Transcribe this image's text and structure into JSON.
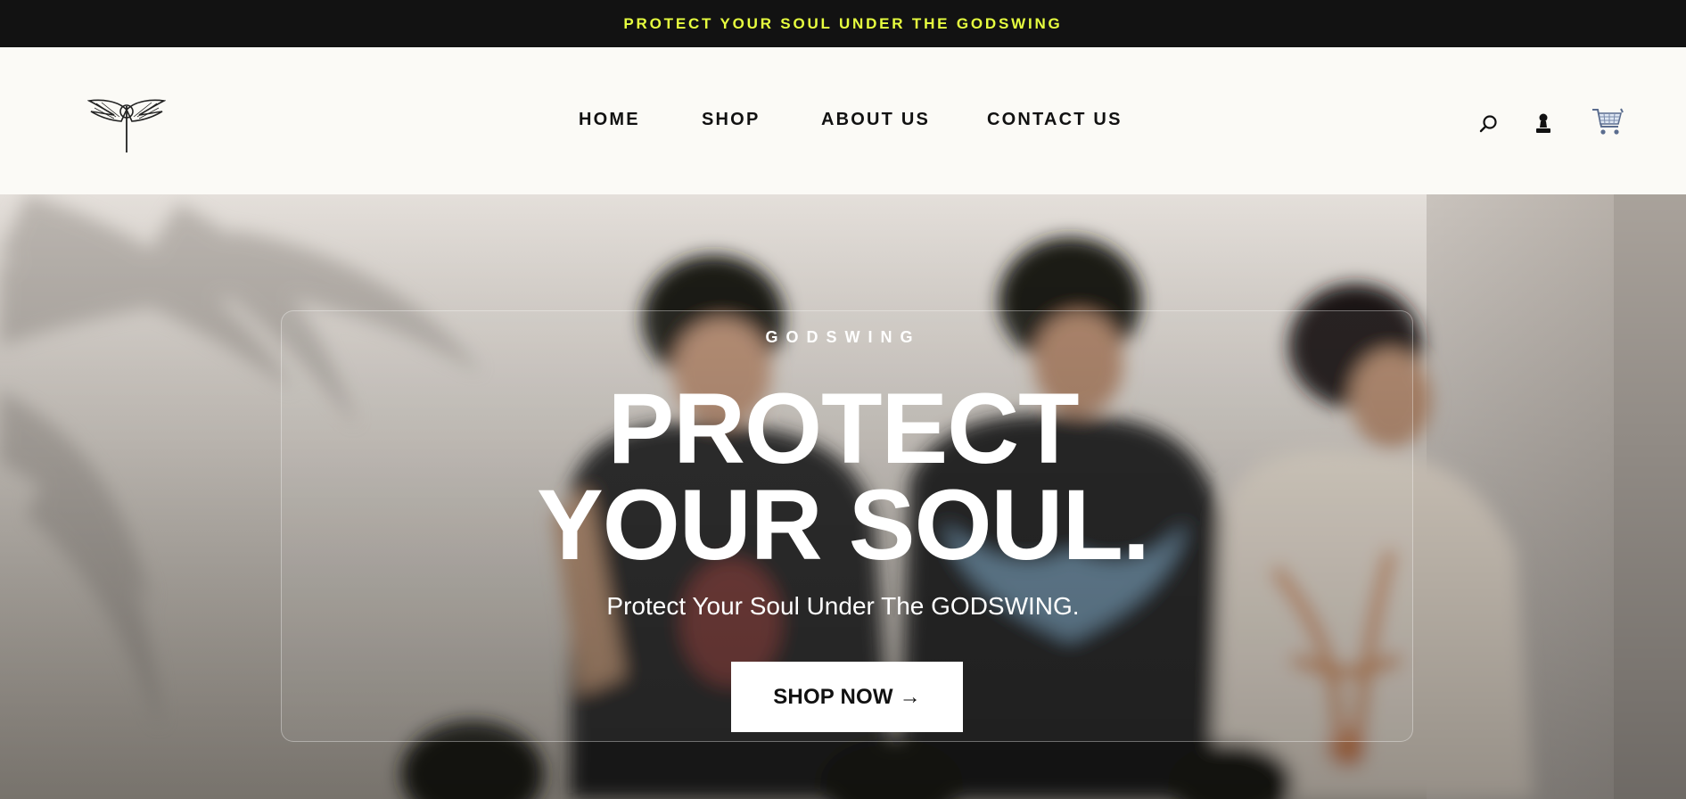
{
  "announcement": {
    "text": "PROTECT YOUR SOUL UNDER THE GODSWING",
    "text_color": "#e7ff3f",
    "background": "#121212"
  },
  "header": {
    "logo_icon": "winged-logo-icon",
    "nav": [
      {
        "label": "HOME"
      },
      {
        "label": "SHOP"
      },
      {
        "label": "ABOUT US"
      },
      {
        "label": "CONTACT US"
      }
    ],
    "icons": [
      "search-icon",
      "account-icon",
      "cart-icon"
    ]
  },
  "hero": {
    "eyebrow": "GODSWING",
    "headline_line1": "PROTECT",
    "headline_line2": "YOUR SOUL.",
    "subtitle": "Protect Your Soul Under The GODSWING.",
    "cta_label": "SHOP NOW →",
    "image_description_icon": "hero-photo"
  }
}
